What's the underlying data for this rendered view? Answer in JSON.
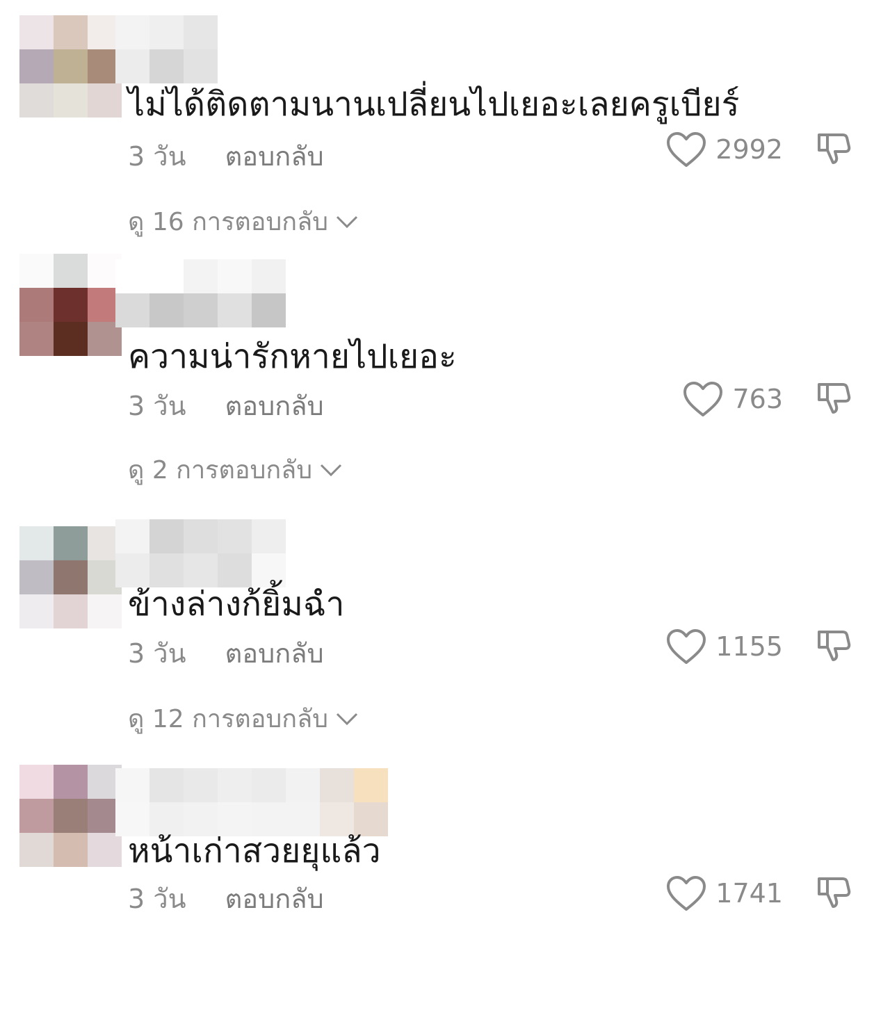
{
  "comments": [
    {
      "text": "ไม่ได้ติดตามนานเปลี่ยนไปเยอะเลยครูเบียร์",
      "time": "3 วัน",
      "reply_label": "ตอบกลับ",
      "likes": "2992",
      "view_replies": "ดู 16 การตอบกลับ"
    },
    {
      "text": "ความน่ารักหายไปเยอะ",
      "time": "3 วัน",
      "reply_label": "ตอบกลับ",
      "likes": "763",
      "view_replies": "ดู 2 การตอบกลับ"
    },
    {
      "text": "ข้างล่างก้ยิ้มฉำ",
      "time": "3 วัน",
      "reply_label": "ตอบกลับ",
      "likes": "1155",
      "view_replies": "ดู 12 การตอบกลับ"
    },
    {
      "text": "หน้าเก่าสวยยุแล้ว",
      "time": "3 วัน",
      "reply_label": "ตอบกลับ",
      "likes": "1741"
    }
  ],
  "icons": {
    "like": "heart-outline-icon",
    "dislike": "thumbs-down-outline-icon",
    "expand": "chevron-down-icon"
  },
  "colors": {
    "text": "#1a1a1a",
    "meta": "#8a8a8a"
  }
}
